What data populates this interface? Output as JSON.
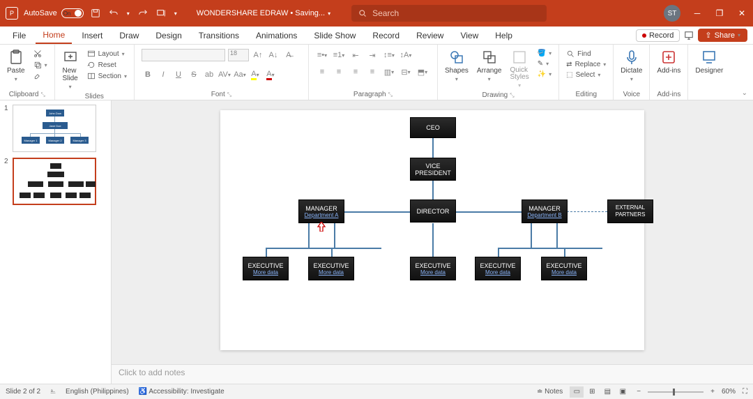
{
  "title_bar": {
    "autosave": "AutoSave",
    "autosave_state": "On",
    "doc_title": "WONDERSHARE EDRAW • Saving...",
    "search_placeholder": "Search",
    "user_initials": "ST"
  },
  "tabs": {
    "file": "File",
    "home": "Home",
    "insert": "Insert",
    "draw": "Draw",
    "design": "Design",
    "transitions": "Transitions",
    "animations": "Animations",
    "slideshow": "Slide Show",
    "record": "Record",
    "review": "Review",
    "view": "View",
    "help": "Help",
    "record_btn": "Record",
    "share_btn": "Share"
  },
  "ribbon": {
    "clipboard": {
      "paste": "Paste",
      "label": "Clipboard"
    },
    "slides": {
      "new_slide": "New\nSlide",
      "layout": "Layout",
      "reset": "Reset",
      "section": "Section",
      "label": "Slides"
    },
    "font": {
      "size": "18",
      "label": "Font"
    },
    "paragraph": {
      "label": "Paragraph"
    },
    "drawing": {
      "shapes": "Shapes",
      "arrange": "Arrange",
      "quick": "Quick\nStyles",
      "label": "Drawing"
    },
    "editing": {
      "find": "Find",
      "replace": "Replace",
      "select": "Select",
      "label": "Editing"
    },
    "voice": {
      "dictate": "Dictate",
      "label": "Voice"
    },
    "addins": {
      "addins": "Add-ins",
      "label": "Add-ins"
    },
    "designer": {
      "designer": "Designer"
    }
  },
  "thumbs": {
    "t1": {
      "top": "John Dow",
      "mid": "Jane Doe",
      "b1": "Manager 1",
      "b2": "Manager 2",
      "b3": "Manager 3"
    }
  },
  "org": {
    "ceo": "CEO",
    "vp": "VICE PRESIDENT",
    "director": "DIRECTOR",
    "mgrA": "MANAGER",
    "mgrA_link": "Department A",
    "mgrB": "MANAGER",
    "mgrB_link": "Department B",
    "external": "EXTERNAL PARTNERS",
    "exec": "EXECUTIVE",
    "more": "More data"
  },
  "notes_placeholder": "Click to add notes",
  "status": {
    "slide": "Slide 2 of 2",
    "lang": "English (Philippines)",
    "access": "Accessibility: Investigate",
    "notes": "Notes",
    "zoom": "60%"
  }
}
